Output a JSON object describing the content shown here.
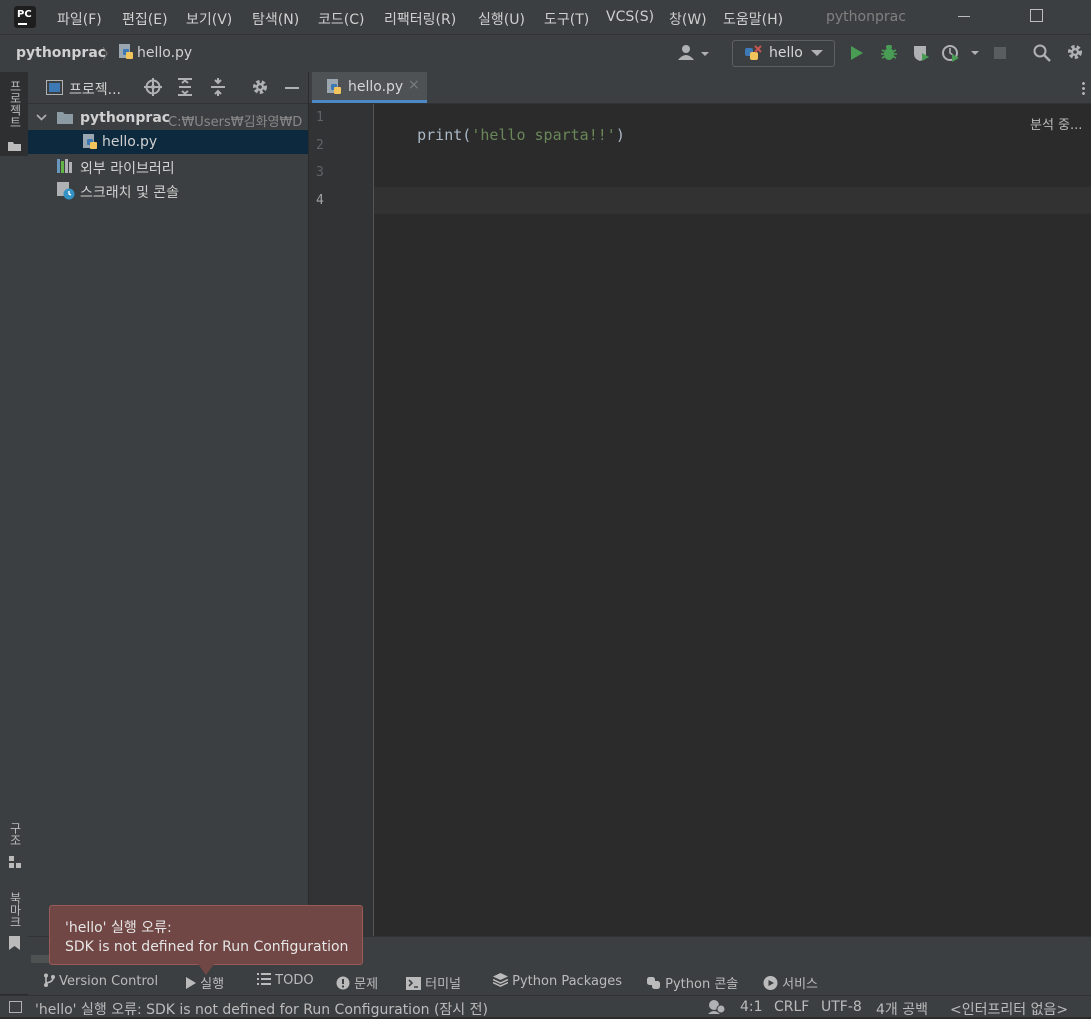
{
  "menu": {
    "items": [
      "파일(F)",
      "편집(E)",
      "보기(V)",
      "탐색(N)",
      "코드(C)",
      "리팩터링(R)",
      "실행(U)",
      "도구(T)",
      "VCS(S)",
      "창(W)",
      "도움말(H)"
    ],
    "window_title": "pythonprac",
    "logo_text": "PC"
  },
  "navbar": {
    "project": "pythonprac",
    "separator": "〉",
    "file": "hello.py",
    "run_config": "hello"
  },
  "left_strip": {
    "project": "프로젝트",
    "structure": "구조",
    "bookmarks": "북마크"
  },
  "project_panel": {
    "title": "프로젝...",
    "root_name": "pythonprac",
    "root_path": "C:₩Users₩김화영₩D",
    "file": "hello.py",
    "external_libs": "외부 라이브러리",
    "scratches": "스크래치 및 콘솔"
  },
  "editor": {
    "tab": "hello.py",
    "tab_close": "×",
    "line_numbers": [
      "1",
      "2",
      "3",
      "4"
    ],
    "code": {
      "fn": "print",
      "open": "(",
      "string": "'hello sparta!!'",
      "close": ")"
    },
    "analyzing": "분석 중..."
  },
  "balloon": {
    "title": "'hello' 실행 오류:",
    "message": "SDK is not defined for Run Configuration"
  },
  "bottom_tabs": [
    "Version Control",
    "실행",
    "TODO",
    "문제",
    "터미널",
    "Python Packages",
    "Python 콘솔",
    "서비스"
  ],
  "status": {
    "message": "'hello' 실행 오류: SDK is not defined for Run Configuration (잠시 전)",
    "position": "4:1",
    "line_sep": "CRLF",
    "encoding": "UTF-8",
    "indent": "4개 공백",
    "interpreter": "<인터프리터 없음>"
  },
  "colors": {
    "background": "#2b2b2b",
    "panel": "#3c3f41",
    "selection": "#0d293e",
    "string": "#6a8759",
    "run_green": "#499c54",
    "balloon": "#704745"
  }
}
